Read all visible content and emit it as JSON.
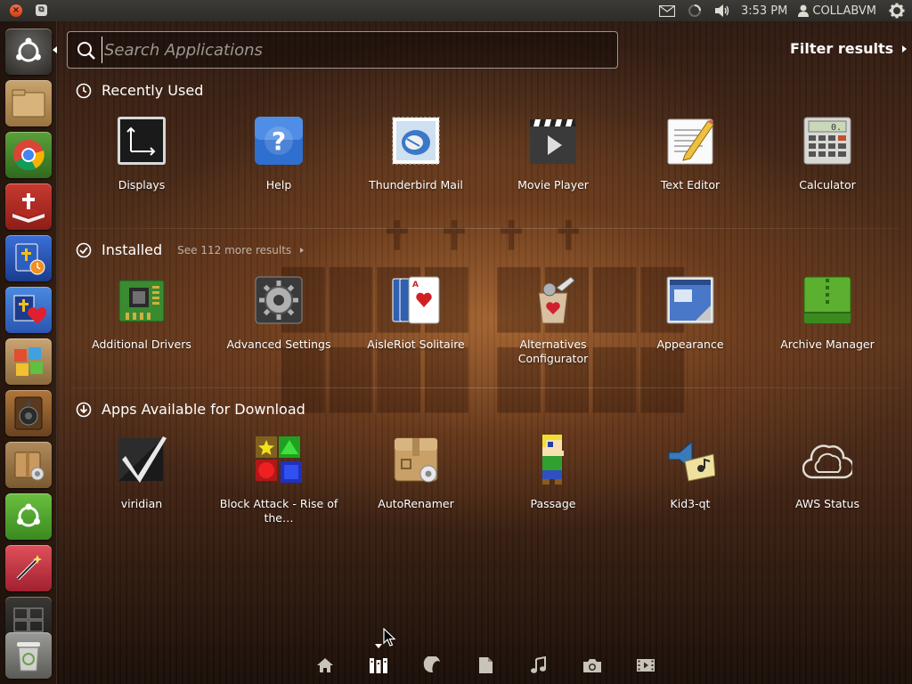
{
  "top_panel": {
    "close_glyph": "×",
    "maximize_glyph": "⧉",
    "time": "3:53 PM",
    "user": "COLLABVM",
    "icons": [
      "mail-icon",
      "network-spinner-icon",
      "volume-icon",
      "user-icon",
      "gear-icon"
    ]
  },
  "launcher": {
    "items": [
      {
        "name": "dash-home-icon"
      },
      {
        "name": "files-icon"
      },
      {
        "name": "chrome-icon"
      },
      {
        "name": "bible-app-icon"
      },
      {
        "name": "bible-time-icon"
      },
      {
        "name": "bible-heart-icon"
      },
      {
        "name": "puzzle-app-icon"
      },
      {
        "name": "speaker-app-icon"
      },
      {
        "name": "package-installer-icon"
      },
      {
        "name": "ubuntu-software-icon"
      },
      {
        "name": "magic-wand-icon"
      },
      {
        "name": "workspace-switcher-icon"
      },
      {
        "name": "trash-icon"
      }
    ]
  },
  "search": {
    "placeholder": "Search Applications",
    "value": ""
  },
  "filter": {
    "label": "Filter results"
  },
  "sections": {
    "recent": {
      "title": "Recently Used",
      "apps": [
        {
          "label": "Displays"
        },
        {
          "label": "Help"
        },
        {
          "label": "Thunderbird Mail"
        },
        {
          "label": "Movie Player"
        },
        {
          "label": "Text Editor"
        },
        {
          "label": "Calculator"
        }
      ]
    },
    "installed": {
      "title": "Installed",
      "more": "See 112 more results",
      "apps": [
        {
          "label": "Additional Drivers"
        },
        {
          "label": "Advanced Settings"
        },
        {
          "label": "AisleRiot Solitaire"
        },
        {
          "label": "Alternatives Configurator"
        },
        {
          "label": "Appearance"
        },
        {
          "label": "Archive Manager"
        }
      ]
    },
    "download": {
      "title": "Apps Available for Download",
      "apps": [
        {
          "label": "viridian"
        },
        {
          "label": "Block Attack - Rise of the…"
        },
        {
          "label": "AutoRenamer"
        },
        {
          "label": "Passage"
        },
        {
          "label": "Kid3-qt"
        },
        {
          "label": "AWS Status"
        }
      ]
    }
  },
  "lenses": [
    {
      "name": "home-lens-icon",
      "active": false
    },
    {
      "name": "applications-lens-icon",
      "active": true
    },
    {
      "name": "social-lens-icon",
      "active": false
    },
    {
      "name": "files-lens-icon",
      "active": false
    },
    {
      "name": "music-lens-icon",
      "active": false
    },
    {
      "name": "photos-lens-icon",
      "active": false
    },
    {
      "name": "video-lens-icon",
      "active": false
    }
  ],
  "colors": {
    "accent": "#dd4814",
    "panel": "#3c3b37"
  }
}
